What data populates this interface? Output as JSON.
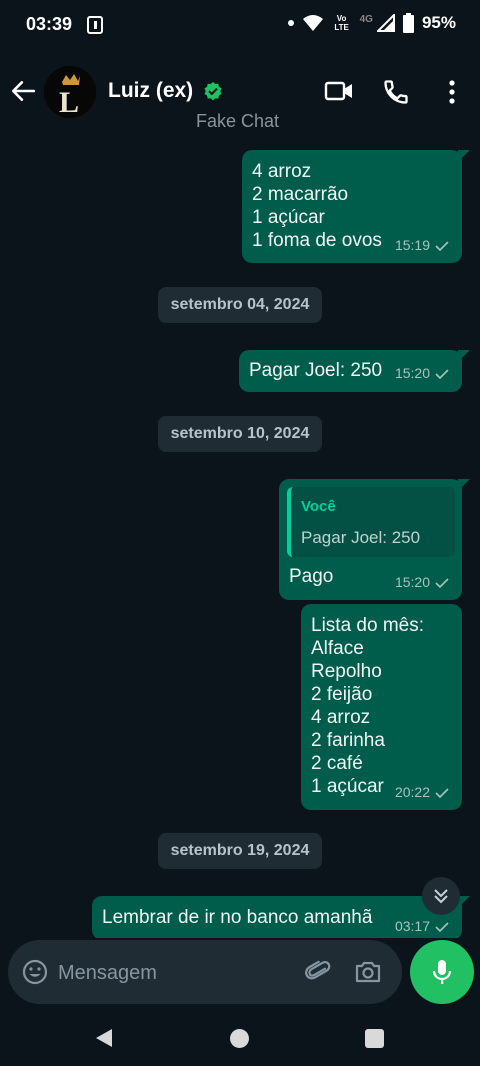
{
  "status_bar": {
    "time": "03:39",
    "volte": "Vo LTE",
    "network": "4G",
    "battery": "95%"
  },
  "header": {
    "contact_name": "Luiz (ex)",
    "subtitle": "Fake Chat",
    "avatar_letter": "L"
  },
  "messages": [
    {
      "text": "4 arroz\n2 macarrão\n1 açúcar\n1 foma de ovos",
      "time": "15:19"
    },
    {
      "text": "Pagar Joel: 250",
      "time": "15:20"
    },
    {
      "quote_author": "Você",
      "quote_text": "Pagar Joel: 250",
      "text": "Pago",
      "time": "15:20"
    },
    {
      "text": "Lista do mês:\nAlface\nRepolho\n2 feijão\n4 arroz\n2 farinha\n2 café\n1 açúcar",
      "time": "20:22"
    },
    {
      "text": "Lembrar de ir no banco amanhã",
      "time": "03:17"
    }
  ],
  "date_chips": [
    "setembro 04, 2024",
    "setembro 10, 2024",
    "setembro 19, 2024"
  ],
  "composer": {
    "placeholder": "Mensagem"
  },
  "colors": {
    "background": "#0b141a",
    "bubble_outgoing": "#005c4b",
    "accent_green": "#21c063",
    "date_chip": "#1f2c34"
  }
}
